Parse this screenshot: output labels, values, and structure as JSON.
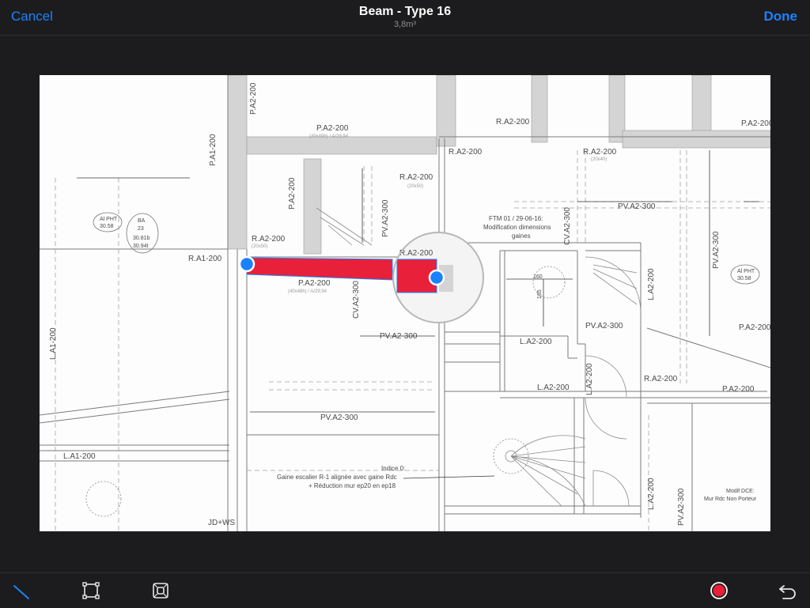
{
  "nav": {
    "cancel_label": "Cancel",
    "done_label": "Done",
    "title": "Beam - Type 16",
    "subtitle": "3,8m³"
  },
  "plan": {
    "labels": {
      "pa1_200_left": "P.A1-200",
      "ra1_200": "R.A1-200",
      "ra2_200_a": "R.A2-200",
      "pa2_200_beam": "P.A2-200",
      "pa2_200_top": "P.A2-200",
      "pa2_200_top_left": "P.A2-200",
      "pa2_200_vert": "P.A2-200",
      "ra2_200_mid": "R.A2-200",
      "ra2_200_lens": "R.A2-200",
      "ra2_200_top_mid": "R.A2-200",
      "ra2_200_top_right": "R.A2-200",
      "ra2_200_top_far": "R.A2-200",
      "pa2_200_top_far": "P.A2-200",
      "pa2_200_right": "P.A2-200",
      "pv_a2_300_vert": "PV.A2-300",
      "cv_a2_300": "CV.A2-300",
      "cv_a2_300_right": "CV.A2-300",
      "pv_a2_300_mid": "PV.A2-300",
      "pv_a2_300_bottom": "PV.A2-300",
      "pv_a2_300_right_top": "PV.A2-300",
      "pv_a2_300_right_vert": "PV.A2-300",
      "pv_a2_300_room": "PV.A2-300",
      "pv_a2_300_bottom_right": "PV.A2-300",
      "la2_200_room": "L.A2-200",
      "la2_200_bottom": "L.A2-200",
      "la2_200_vert": "L.A2-200",
      "la2_200_right_vert": "L.A2-200",
      "la2_200_right_low": "L.A2-200",
      "la1_200_bottom": "L.A1-200",
      "la1_200_left_vert": "L.A1-200",
      "ra2_200_right": "R.A2-200",
      "pa2_200_right_low": "P.A2-200",
      "ftm_note_1": "FTM 01 / 29-06-16:",
      "ftm_note_2": "Modification dimensions",
      "ftm_note_3": "gaines",
      "indice_1": "Indice 0:",
      "indice_2": "Gaine escalier R-1 alignée avec gaine Rdc",
      "indice_3": "+ Réduction mur ep20 en ep18",
      "jd_ws": "JD+WS",
      "al_pht": "Al PHT",
      "al_pht_val": "30.58",
      "al_pht_right": "Al PHT",
      "al_pht_right_val": "30.58",
      "ba": "BA",
      "ba_num": "23",
      "ba_v1": "30.81b",
      "ba_v2": "30.94t",
      "modif_1": "Modif DCE:",
      "modif_2": "Mur Rdc Non Porteur",
      "d160": "160",
      "d185": "185",
      "sub_40x49": "(40x49h) / A/29,94",
      "sub_40x48": "(40x48h) / A/29,94",
      "sub_20x50": "(20x50)",
      "sub_20x40": "(20x40)"
    }
  },
  "beam": {
    "color": "#e8203a",
    "handle_color": "#1a82ff"
  },
  "toolbar": {
    "line_tool": "line-tool-icon",
    "rect_tool": "rectangle-tool-icon",
    "area_tool": "area-tool-icon",
    "color_tool": "color-picker-icon",
    "undo": "undo-icon",
    "accent": "#1a82ff",
    "record_color": "#e8203a"
  }
}
